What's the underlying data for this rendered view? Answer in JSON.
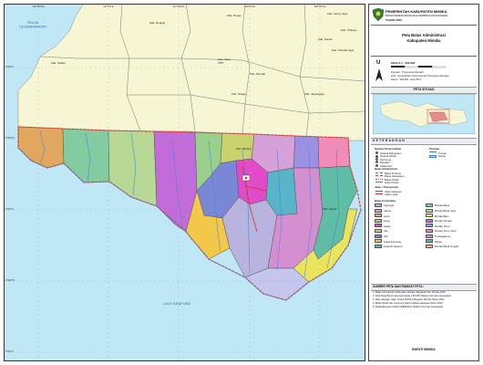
{
  "map": {
    "place_labels": {
      "teluk": "TELUK\nCENDRAWASIH",
      "laut": "LAUT ARAFURA",
      "kab_nabire": "Kab. Nabire",
      "kab_deiyai": "Kab. Deiyai",
      "kab_dogiyai": "Kab. Dogiyai",
      "kab_paniai": "Kab. Paniai",
      "kab_intan_jaya": "Kab. Intan\nJaya",
      "kab_puncak": "Kab. Puncak",
      "kab_puncak_jaya": "Kab. Puncak Jaya",
      "kab_tolikara": "Kab. Tolikara",
      "kab_jayawijaya": "Kab. Jayawijaya",
      "kab_lanny_jaya": "Kab. Lanny Jaya",
      "kab_nduga": "Kab. Nduga",
      "kab_asmat": "Kab. Asmat",
      "kab_mimika": "Kab. Mimika"
    },
    "grid_labels_top": [
      "136°30'0\"E",
      "137°0'0\"E",
      "137°30'0\"E",
      "138°0'0\"E",
      "138°30'0\"E"
    ],
    "grid_labels_left": [
      "3°0'0\"S",
      "3°30'0\"S",
      "4°0'0\"S",
      "4°30'0\"S",
      "5°0'0\"S"
    ],
    "colors": {
      "sea": "#bfe7f6",
      "land": "#f7f6d4",
      "boundary": "#e04040",
      "road": "#d12f2f",
      "river": "#3f7fd8",
      "frame": "#333333"
    }
  },
  "panel": {
    "header": {
      "line1": "PEMERINTAH KABUPATEN MIMIKA",
      "line2": "BADAN PERENCANAAN DAN PEMBANGUNAN DAERAH",
      "line3": "TAHUN 2022"
    },
    "title": {
      "line1": "Peta Batas Administrasi",
      "line2": "Kabupaten Mimika"
    },
    "scale": "SKALA 1 : 400.000",
    "north_letter": "U",
    "projection_lines": [
      "Proyeksi : Transverse Mercator",
      "Grid : Geografi dan Grid Universal Transverse Mercator",
      "Datum : WGS84 - Zone 53 S"
    ],
    "inset_title": "PETA SITUASI",
    "keterangan_title": "KETERANGAN",
    "legend_left_title": "Ibukota Pemerintahan",
    "legend_left": [
      "Ibukota Kabupaten",
      "Ibukota Distrik",
      "Kampung",
      "Bandara",
      "Pelabuhan"
    ],
    "legend_right_title": "Perairan",
    "legend_right": [
      "Sungai",
      "Danau"
    ],
    "batas_title": "Batas Administrasi",
    "batas_items": [
      "Batas Provinsi",
      "Batas Kabupaten",
      "Batas Distrik",
      "Garis Pantai"
    ],
    "jalan_title": "Jalan / Transportasi",
    "jalan_items": [
      "Jalan Nasional",
      "Jalan Lokal"
    ],
    "wilayah_title": "Batas Kecamatan",
    "wilayah": [
      {
        "name": "Agimuga",
        "color": "#b8b3df"
      },
      {
        "name": "Alama",
        "color": "#d6a0d9"
      },
      {
        "name": "Amar",
        "color": "#e1a75d"
      },
      {
        "name": "Hoya",
        "color": "#9ad08d"
      },
      {
        "name": "Iwaka",
        "color": "#e24bc7"
      },
      {
        "name": "Jila",
        "color": "#c9d36c"
      },
      {
        "name": "Jita",
        "color": "#7a86d6"
      },
      {
        "name": "Kuala Kencana",
        "color": "#f2c84b"
      },
      {
        "name": "Kwamki Narama",
        "color": "#58b4c8"
      },
      {
        "name": "Mimika Barat",
        "color": "#83cba0"
      },
      {
        "name": "Mimika Barat Jauh",
        "color": "#b8d995"
      },
      {
        "name": "Mimika Baru",
        "color": "#e9e45c"
      },
      {
        "name": "Mimika Tengah",
        "color": "#c16cd9"
      },
      {
        "name": "Mimika Timur",
        "color": "#9a91e5"
      },
      {
        "name": "Mimika Timur Jauh",
        "color": "#f08cb6"
      },
      {
        "name": "Tembagapura",
        "color": "#d48fd1"
      },
      {
        "name": "Wania",
        "color": "#5fbda6"
      },
      {
        "name": "Mimika Barat Tengah",
        "color": "#e8b28e"
      }
    ],
    "sources_title": "SUMBER PETA DAN RIWAYAT PETA :",
    "sources": [
      "1. Batas Administrasi Kabupaten Mimika, Bappeda Kab. Mimika 2022",
      "2. Peta Rupa Bumi Indonesia Skala 1:50.000, Badan Informasi Geospasial",
      "3. Data Jaringan Jalan, Dinas PUPR Kabupaten Mimika Tahun 2021",
      "4. Batas Distrik dan Kampung hasil verifikasi lapangan Tahun 2022",
      "5. Digital Elevation Model (DEMNAS), Badan Informasi Geospasial"
    ],
    "signature": "BUPATI MIMIKA"
  }
}
